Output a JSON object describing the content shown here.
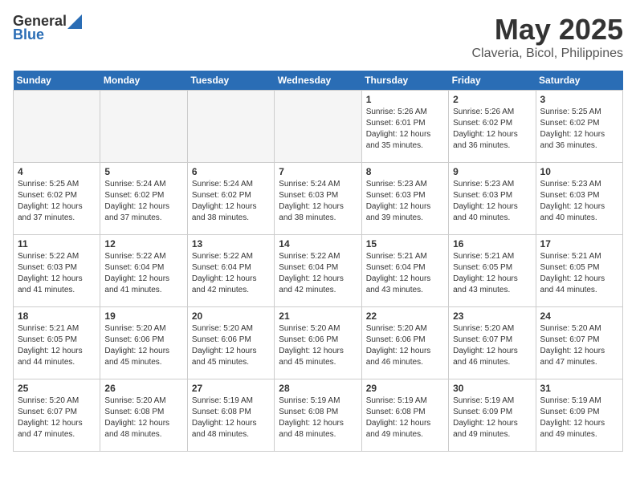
{
  "header": {
    "logo_general": "General",
    "logo_blue": "Blue",
    "month": "May 2025",
    "location": "Claveria, Bicol, Philippines"
  },
  "days_of_week": [
    "Sunday",
    "Monday",
    "Tuesday",
    "Wednesday",
    "Thursday",
    "Friday",
    "Saturday"
  ],
  "weeks": [
    [
      {
        "day": "",
        "info": "",
        "empty": true
      },
      {
        "day": "",
        "info": "",
        "empty": true
      },
      {
        "day": "",
        "info": "",
        "empty": true
      },
      {
        "day": "",
        "info": "",
        "empty": true
      },
      {
        "day": "1",
        "info": "Sunrise: 5:26 AM\nSunset: 6:01 PM\nDaylight: 12 hours\nand 35 minutes.",
        "empty": false
      },
      {
        "day": "2",
        "info": "Sunrise: 5:26 AM\nSunset: 6:02 PM\nDaylight: 12 hours\nand 36 minutes.",
        "empty": false
      },
      {
        "day": "3",
        "info": "Sunrise: 5:25 AM\nSunset: 6:02 PM\nDaylight: 12 hours\nand 36 minutes.",
        "empty": false
      }
    ],
    [
      {
        "day": "4",
        "info": "Sunrise: 5:25 AM\nSunset: 6:02 PM\nDaylight: 12 hours\nand 37 minutes.",
        "empty": false
      },
      {
        "day": "5",
        "info": "Sunrise: 5:24 AM\nSunset: 6:02 PM\nDaylight: 12 hours\nand 37 minutes.",
        "empty": false
      },
      {
        "day": "6",
        "info": "Sunrise: 5:24 AM\nSunset: 6:02 PM\nDaylight: 12 hours\nand 38 minutes.",
        "empty": false
      },
      {
        "day": "7",
        "info": "Sunrise: 5:24 AM\nSunset: 6:03 PM\nDaylight: 12 hours\nand 38 minutes.",
        "empty": false
      },
      {
        "day": "8",
        "info": "Sunrise: 5:23 AM\nSunset: 6:03 PM\nDaylight: 12 hours\nand 39 minutes.",
        "empty": false
      },
      {
        "day": "9",
        "info": "Sunrise: 5:23 AM\nSunset: 6:03 PM\nDaylight: 12 hours\nand 40 minutes.",
        "empty": false
      },
      {
        "day": "10",
        "info": "Sunrise: 5:23 AM\nSunset: 6:03 PM\nDaylight: 12 hours\nand 40 minutes.",
        "empty": false
      }
    ],
    [
      {
        "day": "11",
        "info": "Sunrise: 5:22 AM\nSunset: 6:03 PM\nDaylight: 12 hours\nand 41 minutes.",
        "empty": false
      },
      {
        "day": "12",
        "info": "Sunrise: 5:22 AM\nSunset: 6:04 PM\nDaylight: 12 hours\nand 41 minutes.",
        "empty": false
      },
      {
        "day": "13",
        "info": "Sunrise: 5:22 AM\nSunset: 6:04 PM\nDaylight: 12 hours\nand 42 minutes.",
        "empty": false
      },
      {
        "day": "14",
        "info": "Sunrise: 5:22 AM\nSunset: 6:04 PM\nDaylight: 12 hours\nand 42 minutes.",
        "empty": false
      },
      {
        "day": "15",
        "info": "Sunrise: 5:21 AM\nSunset: 6:04 PM\nDaylight: 12 hours\nand 43 minutes.",
        "empty": false
      },
      {
        "day": "16",
        "info": "Sunrise: 5:21 AM\nSunset: 6:05 PM\nDaylight: 12 hours\nand 43 minutes.",
        "empty": false
      },
      {
        "day": "17",
        "info": "Sunrise: 5:21 AM\nSunset: 6:05 PM\nDaylight: 12 hours\nand 44 minutes.",
        "empty": false
      }
    ],
    [
      {
        "day": "18",
        "info": "Sunrise: 5:21 AM\nSunset: 6:05 PM\nDaylight: 12 hours\nand 44 minutes.",
        "empty": false
      },
      {
        "day": "19",
        "info": "Sunrise: 5:20 AM\nSunset: 6:06 PM\nDaylight: 12 hours\nand 45 minutes.",
        "empty": false
      },
      {
        "day": "20",
        "info": "Sunrise: 5:20 AM\nSunset: 6:06 PM\nDaylight: 12 hours\nand 45 minutes.",
        "empty": false
      },
      {
        "day": "21",
        "info": "Sunrise: 5:20 AM\nSunset: 6:06 PM\nDaylight: 12 hours\nand 45 minutes.",
        "empty": false
      },
      {
        "day": "22",
        "info": "Sunrise: 5:20 AM\nSunset: 6:06 PM\nDaylight: 12 hours\nand 46 minutes.",
        "empty": false
      },
      {
        "day": "23",
        "info": "Sunrise: 5:20 AM\nSunset: 6:07 PM\nDaylight: 12 hours\nand 46 minutes.",
        "empty": false
      },
      {
        "day": "24",
        "info": "Sunrise: 5:20 AM\nSunset: 6:07 PM\nDaylight: 12 hours\nand 47 minutes.",
        "empty": false
      }
    ],
    [
      {
        "day": "25",
        "info": "Sunrise: 5:20 AM\nSunset: 6:07 PM\nDaylight: 12 hours\nand 47 minutes.",
        "empty": false
      },
      {
        "day": "26",
        "info": "Sunrise: 5:20 AM\nSunset: 6:08 PM\nDaylight: 12 hours\nand 48 minutes.",
        "empty": false
      },
      {
        "day": "27",
        "info": "Sunrise: 5:19 AM\nSunset: 6:08 PM\nDaylight: 12 hours\nand 48 minutes.",
        "empty": false
      },
      {
        "day": "28",
        "info": "Sunrise: 5:19 AM\nSunset: 6:08 PM\nDaylight: 12 hours\nand 48 minutes.",
        "empty": false
      },
      {
        "day": "29",
        "info": "Sunrise: 5:19 AM\nSunset: 6:08 PM\nDaylight: 12 hours\nand 49 minutes.",
        "empty": false
      },
      {
        "day": "30",
        "info": "Sunrise: 5:19 AM\nSunset: 6:09 PM\nDaylight: 12 hours\nand 49 minutes.",
        "empty": false
      },
      {
        "day": "31",
        "info": "Sunrise: 5:19 AM\nSunset: 6:09 PM\nDaylight: 12 hours\nand 49 minutes.",
        "empty": false
      }
    ]
  ]
}
